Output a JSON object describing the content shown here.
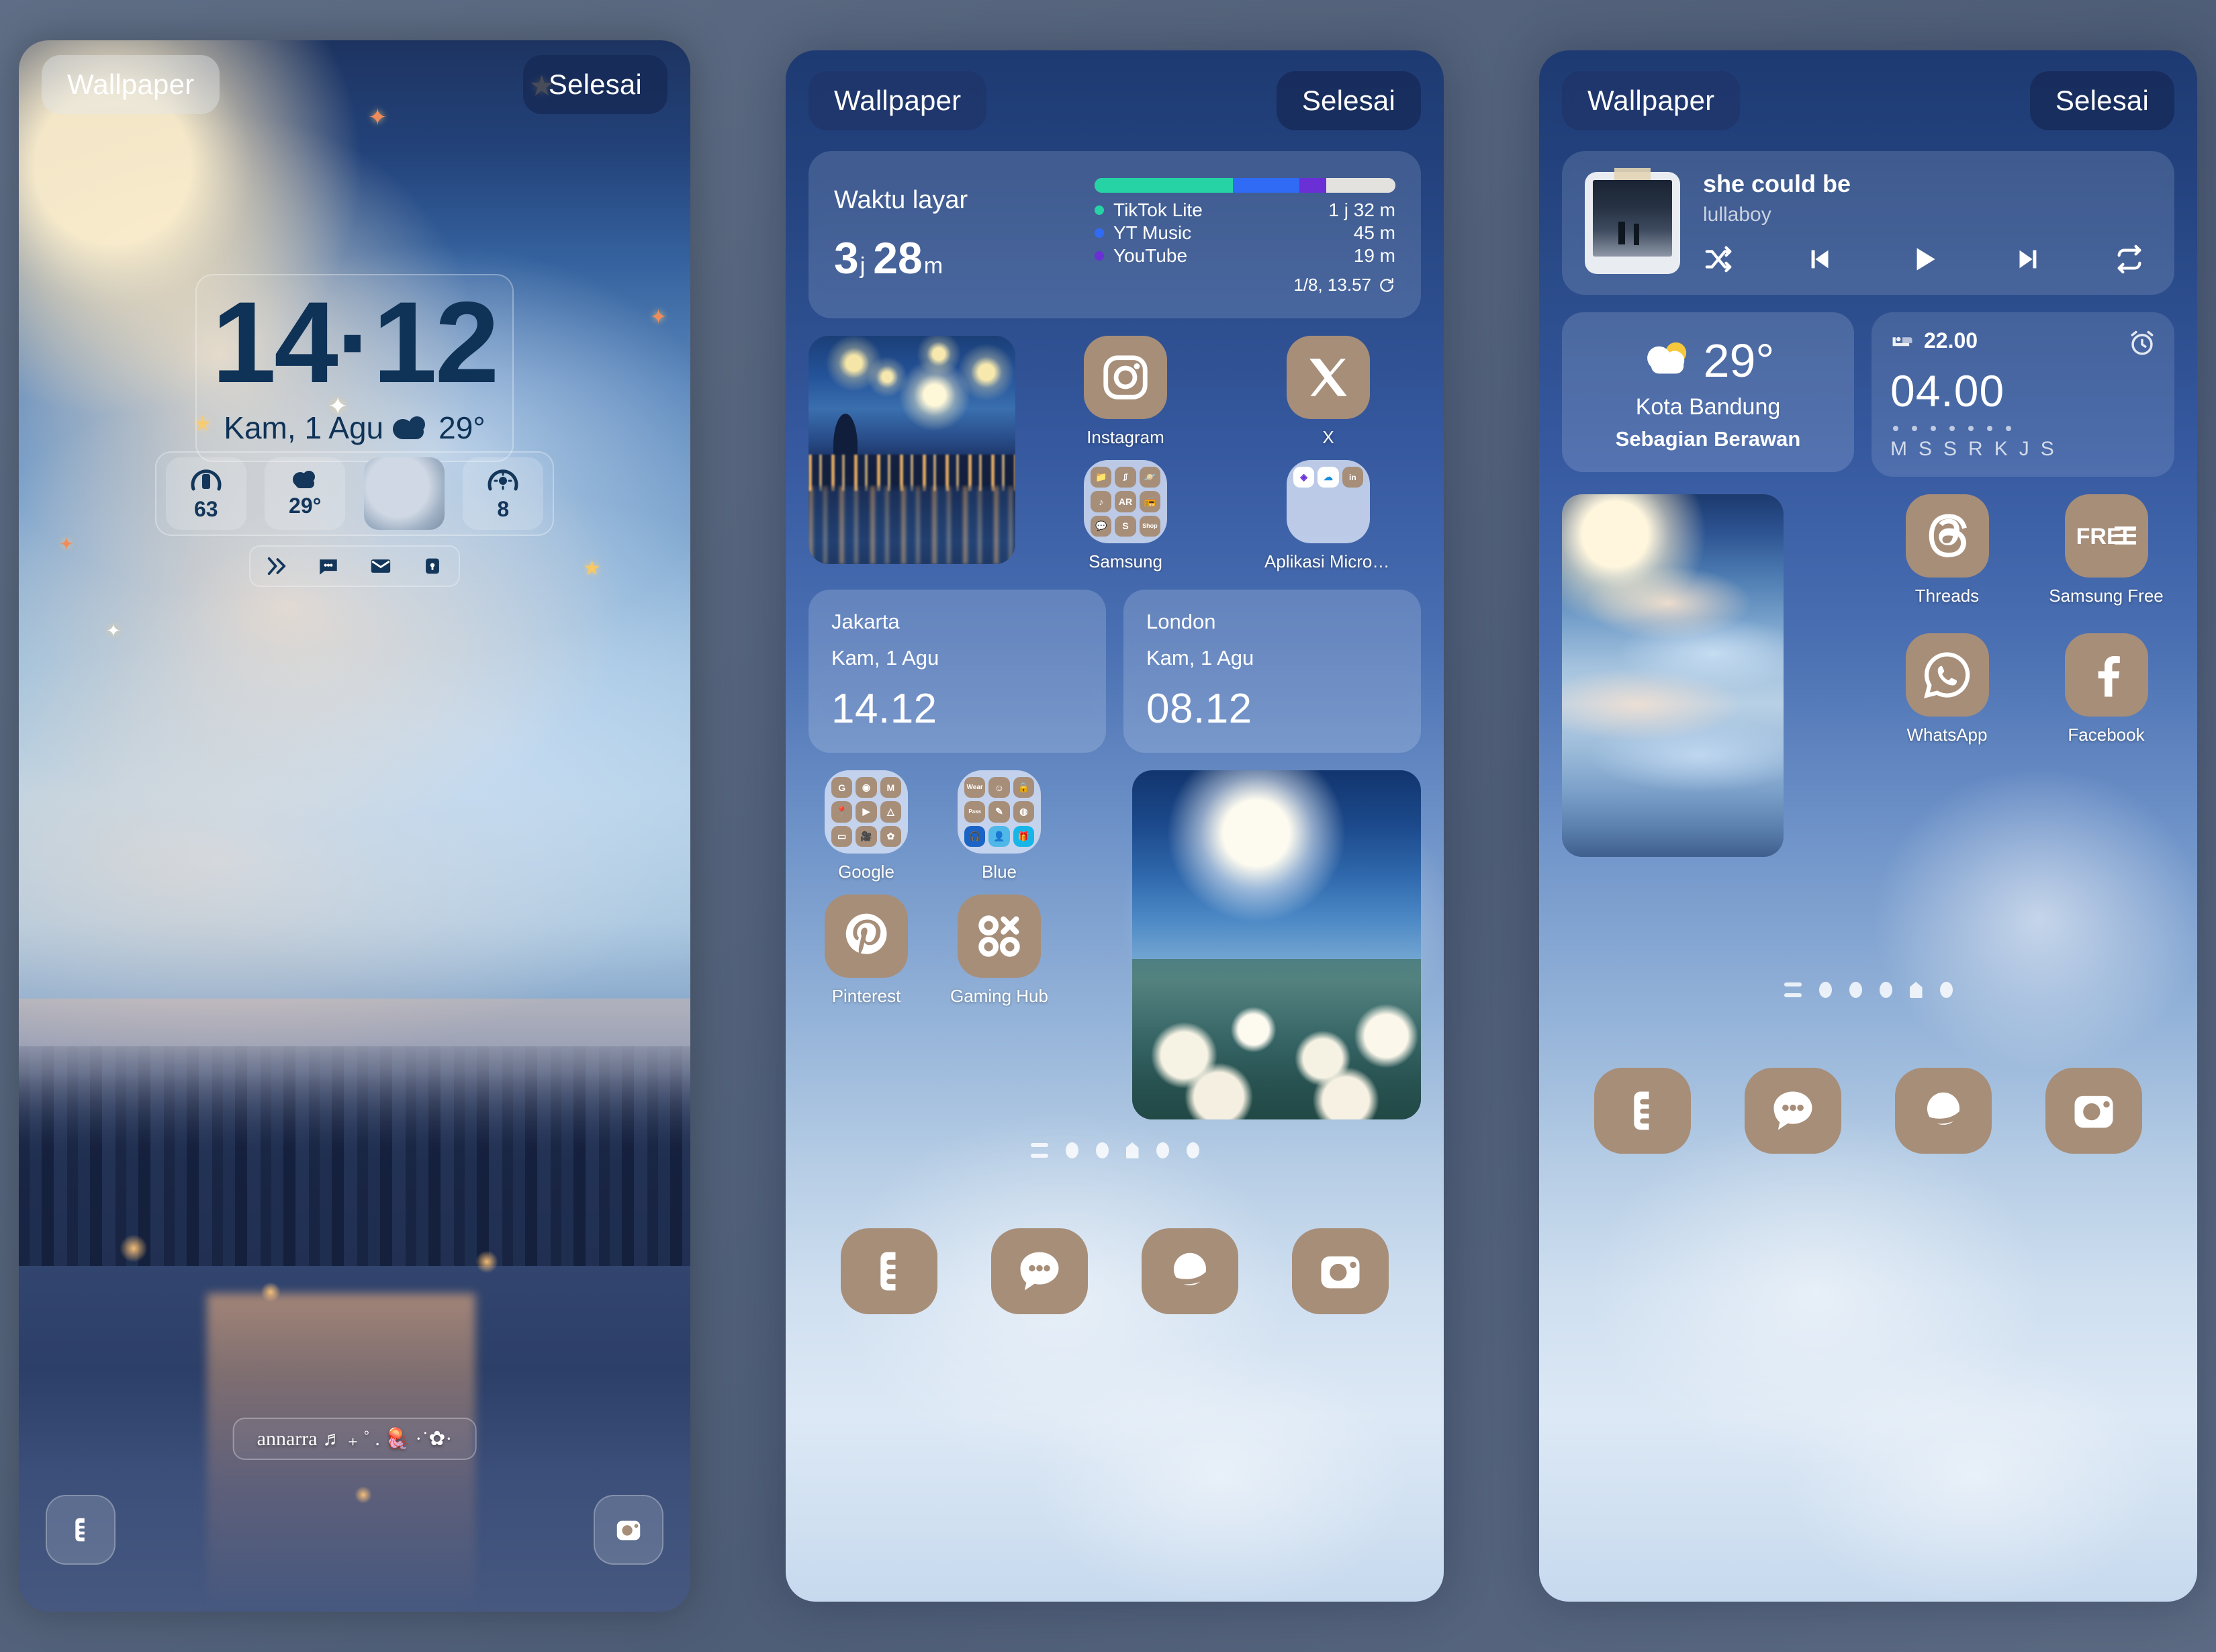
{
  "topbar": {
    "back_label": "Wallpaper",
    "done_label": "Selesai"
  },
  "lock_screen": {
    "time": "14·12",
    "date": "Kam, 1 Agu",
    "temp": "29°",
    "tiles": [
      {
        "name": "battery-tile",
        "value": "63"
      },
      {
        "name": "weather-tile",
        "value": "29°"
      },
      {
        "name": "moon-tile",
        "value": ""
      },
      {
        "name": "brightness-tile",
        "value": "8"
      }
    ],
    "shortcuts": [
      "share-icon",
      "message-icon",
      "mail-icon",
      "lock-icon"
    ],
    "name_text": "annarra ♬ ₊ ˚ . 🪼 ·˙✿·",
    "bottom_left_icon": "phone-icon",
    "bottom_right_icon": "camera-icon"
  },
  "home_screen": {
    "screen_time": {
      "label": "Waktu layar",
      "total_hours": "3",
      "hours_unit": "j",
      "total_minutes": "28",
      "minutes_unit": "m",
      "apps": [
        {
          "name": "TikTok Lite",
          "duration": "1 j 32 m",
          "color": "#25d3a4",
          "pct": 46
        },
        {
          "name": "YT Music",
          "duration": "45 m",
          "color": "#2f6bf5",
          "pct": 22
        },
        {
          "name": "YouTube",
          "duration": "19 m",
          "color": "#6b2fd6",
          "pct": 9
        }
      ],
      "remaining_color": "#e3e2de",
      "updated": "1/8, 13.57",
      "refresh_icon": "refresh-icon"
    },
    "starry_widget": "starry-night-image",
    "row1_apps": [
      {
        "label": "Instagram",
        "icon": "instagram-icon",
        "type": "app"
      },
      {
        "label": "X",
        "icon": "x-twitter-icon",
        "type": "app"
      },
      {
        "label": "Samsung",
        "icon": "samsung-folder",
        "type": "folder"
      },
      {
        "label": "Aplikasi Microsoft",
        "icon": "microsoft-folder",
        "type": "folder"
      }
    ],
    "clocks": [
      {
        "city": "Jakarta",
        "date": "Kam, 1 Agu",
        "time": "14.12"
      },
      {
        "city": "London",
        "date": "Kam, 1 Agu",
        "time": "08.12"
      }
    ],
    "row2_apps": [
      {
        "label": "Google",
        "icon": "google-folder",
        "type": "folder"
      },
      {
        "label": "Blue",
        "icon": "blue-folder",
        "type": "folder"
      },
      {
        "label": "Pinterest",
        "icon": "pinterest-icon",
        "type": "app"
      },
      {
        "label": "Gaming Hub",
        "icon": "gaming-hub-icon",
        "type": "app"
      }
    ],
    "moon_roses_widget": "moon-roses-image",
    "page_indicator": {
      "pages": 5,
      "current": 3,
      "has_list_icon": true
    },
    "dock": [
      {
        "label": "Phone",
        "icon": "phone-icon"
      },
      {
        "label": "Messages",
        "icon": "message-icon"
      },
      {
        "label": "Internet",
        "icon": "internet-icon"
      },
      {
        "label": "Camera",
        "icon": "camera-icon"
      }
    ]
  },
  "home_screen_2": {
    "music": {
      "title": "she could be",
      "artist": "lullaboy",
      "controls": [
        "shuffle-icon",
        "previous-icon",
        "play-icon",
        "next-icon",
        "repeat-icon"
      ]
    },
    "weather": {
      "temp": "29°",
      "city": "Kota Bandung",
      "condition": "Sebagian Berawan",
      "icon": "partly-cloudy-icon"
    },
    "alarm": {
      "bedtime": "22.00",
      "wake_time": "04.00",
      "days": [
        "M",
        "S",
        "S",
        "R",
        "K",
        "J",
        "S"
      ],
      "bed_icon": "bed-icon",
      "clock_icon": "alarm-clock-icon"
    },
    "cloud_widget": "cloud-moon-image",
    "apps": [
      {
        "label": "Threads",
        "icon": "threads-icon"
      },
      {
        "label": "Samsung Free",
        "icon": "samsung-free-icon"
      },
      {
        "label": "WhatsApp",
        "icon": "whatsapp-icon"
      },
      {
        "label": "Facebook",
        "icon": "facebook-icon"
      }
    ],
    "page_indicator": {
      "pages": 5,
      "current": 4,
      "has_list_icon": true
    },
    "dock": [
      {
        "label": "Phone",
        "icon": "phone-icon"
      },
      {
        "label": "Messages",
        "icon": "message-icon"
      },
      {
        "label": "Internet",
        "icon": "internet-icon"
      },
      {
        "label": "Camera",
        "icon": "camera-icon"
      }
    ]
  },
  "colors": {
    "icon_brown": "#a78e79",
    "accent_blue": "#2f6bf5",
    "folder_bg": "#d8e2f5"
  }
}
